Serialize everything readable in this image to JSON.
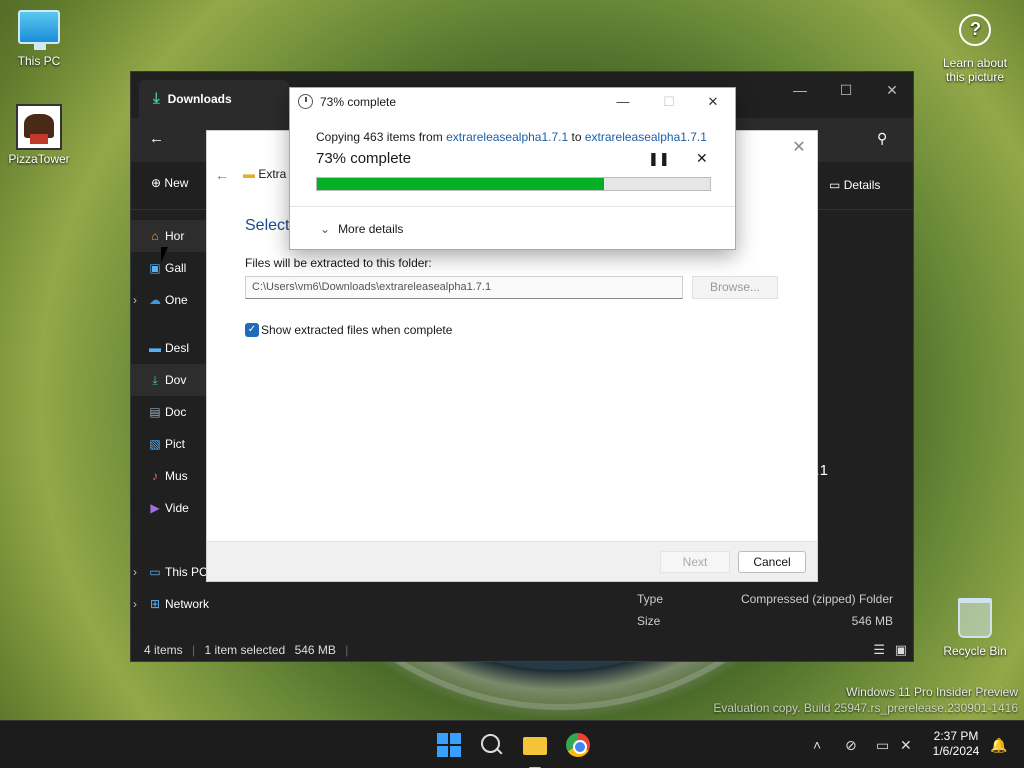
{
  "desktop": {
    "icons": [
      {
        "label": "This PC"
      },
      {
        "label": "PizzaTower"
      },
      {
        "label": "Recycle Bin"
      }
    ],
    "learn_about": "Learn about this picture",
    "watermark": {
      "line1": "Windows 11 Pro Insider Preview",
      "line2": "Evaluation copy. Build 25947.rs_prerelease.230901-1416"
    }
  },
  "explorer": {
    "tab_title": "Downloads",
    "toolbar": {
      "new_label": "New",
      "details_label": "Details"
    },
    "nav": {
      "home": "Hor",
      "gallery": "Gall",
      "onedrive": "One",
      "desktop": "Desl",
      "downloads": "Dov",
      "documents": "Doc",
      "pictures": "Pict",
      "music": "Mus",
      "videos": "Vide",
      "this_pc": "This PC",
      "network": "Network"
    },
    "details_partial": ".7.1",
    "properties": [
      {
        "key": "Type",
        "value": "Compressed (zipped) Folder"
      },
      {
        "key": "Size",
        "value": "546 MB"
      }
    ],
    "status": {
      "items": "4 items",
      "selected": "1 item selected",
      "size": "546 MB"
    }
  },
  "extract_dialog": {
    "breadcrumb": "Extra",
    "heading": "Select",
    "folder_label": "Files will be extracted to this folder:",
    "path_value": "C:\\Users\\vm6\\Downloads\\extrareleasealpha1.7.1",
    "browse_label": "Browse...",
    "checkbox_label": "Show extracted files when complete",
    "checkbox_checked": true,
    "next_label": "Next",
    "cancel_label": "Cancel"
  },
  "progress_dialog": {
    "title": "73% complete",
    "copying_prefix": "Copying 463 items from ",
    "source": "extrareleasealpha1.7.1",
    "to_word": " to ",
    "destination": "extrareleasealpha1.7.1",
    "percent_text": "73% complete",
    "progress": 0.73,
    "more_details": "More details",
    "bar_color": "#06b025"
  },
  "taskbar": {
    "time": "2:37 PM",
    "date": "1/6/2024",
    "pinned": [
      "start-icon",
      "search-icon",
      "file-explorer-icon",
      "chrome-icon"
    ]
  }
}
